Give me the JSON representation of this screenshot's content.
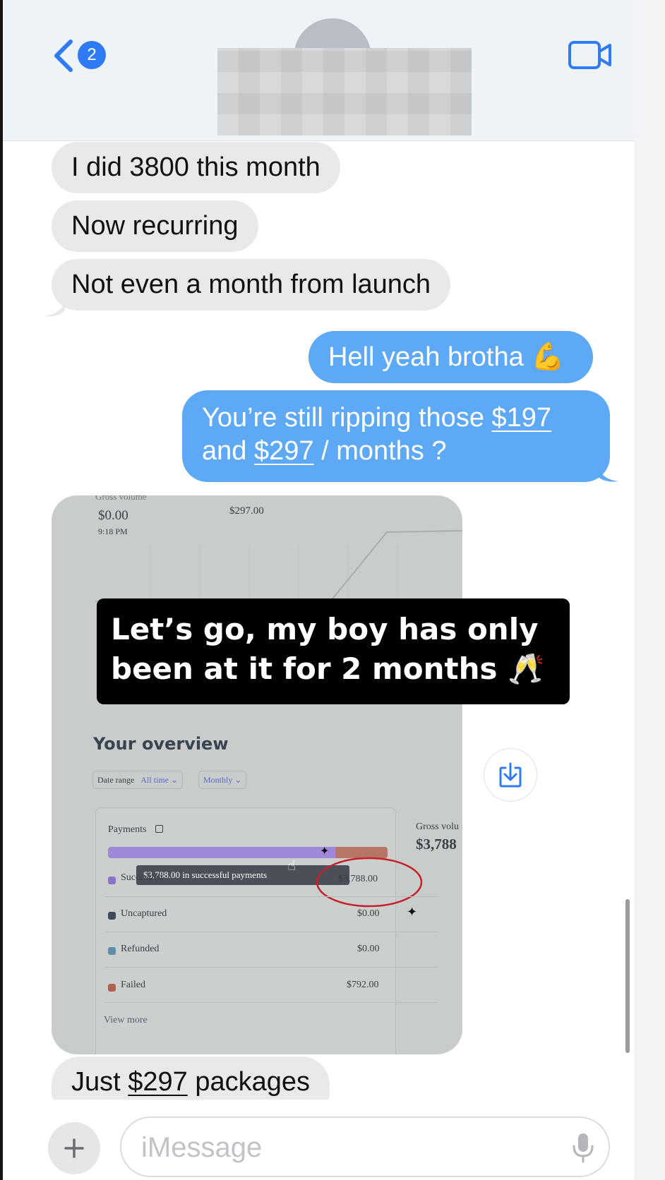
{
  "header": {
    "back_badge_count": "2",
    "contact_name": "",
    "icons": {
      "back": "chevron-left-icon",
      "video": "video-camera-icon"
    }
  },
  "messages": [
    {
      "side": "received",
      "text": "I did 3800 this month"
    },
    {
      "side": "received",
      "text": "Now recurring"
    },
    {
      "side": "received",
      "text": "Not even a month from launch"
    },
    {
      "side": "sent",
      "text": "Hell yeah brotha",
      "emoji": "💪"
    },
    {
      "side": "sent",
      "line1_pre": "You’re still ripping those ",
      "line1_link": "$197",
      "line2_pre": "and ",
      "line2_link": "$297",
      "line2_post": " / months ?"
    },
    {
      "side": "received",
      "type": "photo"
    },
    {
      "side": "received",
      "pre": "Just ",
      "link": "$297",
      "post": " packages"
    }
  ],
  "photo": {
    "gross_label": "Gross volume",
    "top_value": "$0.00",
    "top_time": "9:18 PM",
    "top_value_right": "$297.00",
    "overview_title": "Your overview",
    "date_range_label": "Date range",
    "all_time": "All time",
    "monthly": "Monthly",
    "payments_label": "Payments",
    "tooltip": "$3,788.00 in successful payments",
    "rows": [
      {
        "label": "Succeeded",
        "value": "$3,788.00",
        "color": "#8a73c9"
      },
      {
        "label": "Uncaptured",
        "value": "$0.00",
        "color": "#3e4a5c"
      },
      {
        "label": "Refunded",
        "value": "$0.00",
        "color": "#5f8ea8"
      },
      {
        "label": "Failed",
        "value": "$792.00",
        "color": "#b05e52"
      }
    ],
    "view_more": "View more",
    "gross_side_label": "Gross volu",
    "gross_side_value": "$3,788"
  },
  "overlay": {
    "line1": "Let’s go, my boy has only",
    "line2": "been at it for 2 months",
    "emoji": "🥂"
  },
  "input": {
    "placeholder": "iMessage",
    "icons": {
      "plus": "plus-icon",
      "mic": "microphone-icon",
      "download": "download-icon"
    }
  },
  "colors": {
    "sent_bubble": "#5ea9f5",
    "received_bubble": "#e9e9eb",
    "accent": "#2f7bf6"
  }
}
